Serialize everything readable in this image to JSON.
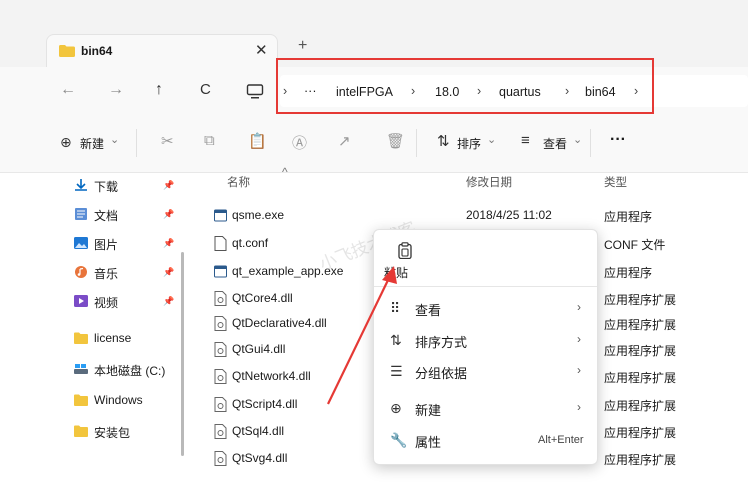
{
  "tab": {
    "title": "bin64",
    "close": "✕",
    "new_tab": "+"
  },
  "nav": {
    "back": "←",
    "forward": "→",
    "up": "↑",
    "refresh": "C"
  },
  "breadcrumb": {
    "items": [
      "intelFPGA",
      "18.0",
      "quartus",
      "bin64"
    ],
    "more": "···",
    "sep": "›"
  },
  "toolbar": {
    "new_label": "新建",
    "sort_label": "排序",
    "view_label": "查看",
    "more": "···",
    "chev": "⌄"
  },
  "sidebar": {
    "items": [
      {
        "label": "下载",
        "pinned": true,
        "icon": "download-icon"
      },
      {
        "label": "文档",
        "pinned": true,
        "icon": "document-icon"
      },
      {
        "label": "图片",
        "pinned": true,
        "icon": "picture-icon"
      },
      {
        "label": "音乐",
        "pinned": true,
        "icon": "music-icon"
      },
      {
        "label": "视频",
        "pinned": true,
        "icon": "video-icon"
      },
      {
        "label": "license",
        "pinned": false,
        "icon": "folder-icon"
      },
      {
        "label": "本地磁盘 (C:)",
        "pinned": false,
        "icon": "drive-icon"
      },
      {
        "label": "Windows",
        "pinned": false,
        "icon": "folder-icon"
      },
      {
        "label": "安装包",
        "pinned": false,
        "icon": "folder-icon"
      }
    ],
    "pin": "📌"
  },
  "columns": {
    "name": "名称",
    "date": "修改日期",
    "type": "类型"
  },
  "files": [
    {
      "name": "qsme.exe",
      "date": "2018/4/25 11:02",
      "type": "应用程序"
    },
    {
      "name": "qt.conf",
      "date": "",
      "type": "CONF 文件"
    },
    {
      "name": "qt_example_app.exe",
      "date": "",
      "type": "应用程序"
    },
    {
      "name": "QtCore4.dll",
      "date": "",
      "type": "应用程序扩展"
    },
    {
      "name": "QtDeclarative4.dll",
      "date": "",
      "type": "应用程序扩展"
    },
    {
      "name": "QtGui4.dll",
      "date": "",
      "type": "应用程序扩展"
    },
    {
      "name": "QtNetwork4.dll",
      "date": "",
      "type": "应用程序扩展"
    },
    {
      "name": "QtScript4.dll",
      "date": "",
      "type": "应用程序扩展"
    },
    {
      "name": "QtSql4.dll",
      "date": "",
      "type": "应用程序扩展"
    },
    {
      "name": "QtSvg4.dll",
      "date": "",
      "type": "应用程序扩展"
    }
  ],
  "context_menu": {
    "paste": "粘贴",
    "items": [
      {
        "label": "查看",
        "arrow": "›",
        "shortcut": ""
      },
      {
        "label": "排序方式",
        "arrow": "›",
        "shortcut": ""
      },
      {
        "label": "分组依据",
        "arrow": "›",
        "shortcut": ""
      },
      {
        "label": "新建",
        "arrow": "›",
        "shortcut": ""
      },
      {
        "label": "属性",
        "arrow": "",
        "shortcut": "Alt+Enter"
      }
    ]
  },
  "watermark": "小飞技术博客",
  "colors": {
    "highlight": "#e53935",
    "arrow": "#e53935",
    "folder": "#f2c53d",
    "accent": "#0067c0"
  }
}
